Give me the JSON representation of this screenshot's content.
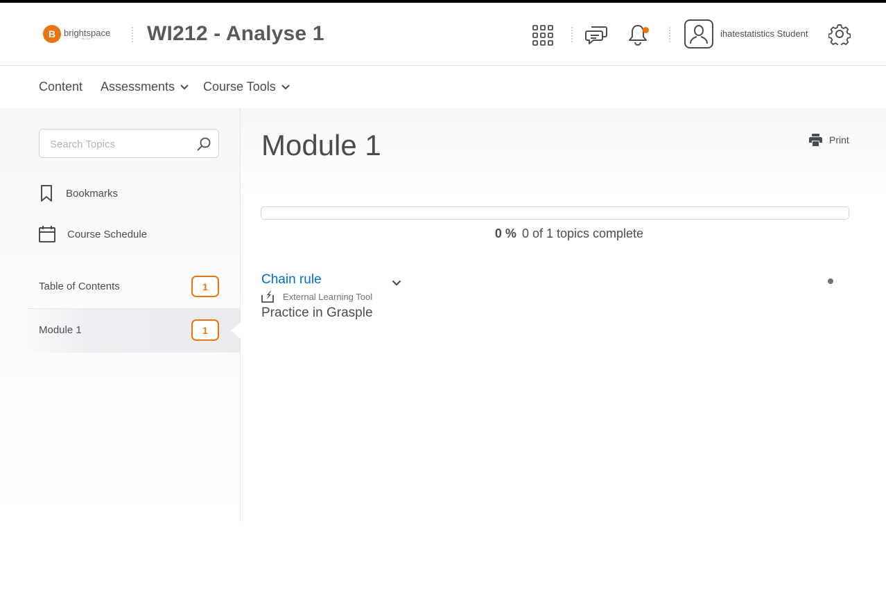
{
  "header": {
    "logo_letter": "B",
    "logo_text": "brightspace",
    "logo_sub": "by D2L",
    "course_title": "WI212 - Analyse 1",
    "icons": [
      "waffle-icon",
      "chat-icon",
      "bell-icon",
      "avatar-icon",
      "gear-icon"
    ],
    "user_name": "ihatestatistics Student",
    "notification_color": "#e87511"
  },
  "nav": {
    "items": [
      {
        "label": "Content",
        "dropdown": false
      },
      {
        "label": "Assessments",
        "dropdown": true
      },
      {
        "label": "Course Tools",
        "dropdown": true
      }
    ]
  },
  "sidebar": {
    "search_placeholder": "Search Topics",
    "links": [
      {
        "label": "Bookmarks",
        "icon": "bookmark-icon"
      },
      {
        "label": "Course Schedule",
        "icon": "calendar-icon"
      }
    ],
    "toc": [
      {
        "label": "Table of Contents",
        "count": "1",
        "active": false
      },
      {
        "label": "Module 1",
        "count": "1",
        "active": true
      }
    ]
  },
  "main": {
    "title": "Module 1",
    "print_label": "Print",
    "progress": {
      "percent_label": "0 %",
      "percent": 0,
      "summary": "0 of 1 topics complete"
    },
    "topics": [
      {
        "title": "Chain rule",
        "type": "External Learning Tool",
        "description": "Practice in Grasple"
      }
    ]
  },
  "colors": {
    "accent": "#e87511",
    "link": "#006fbf",
    "text": "#494c4e"
  }
}
